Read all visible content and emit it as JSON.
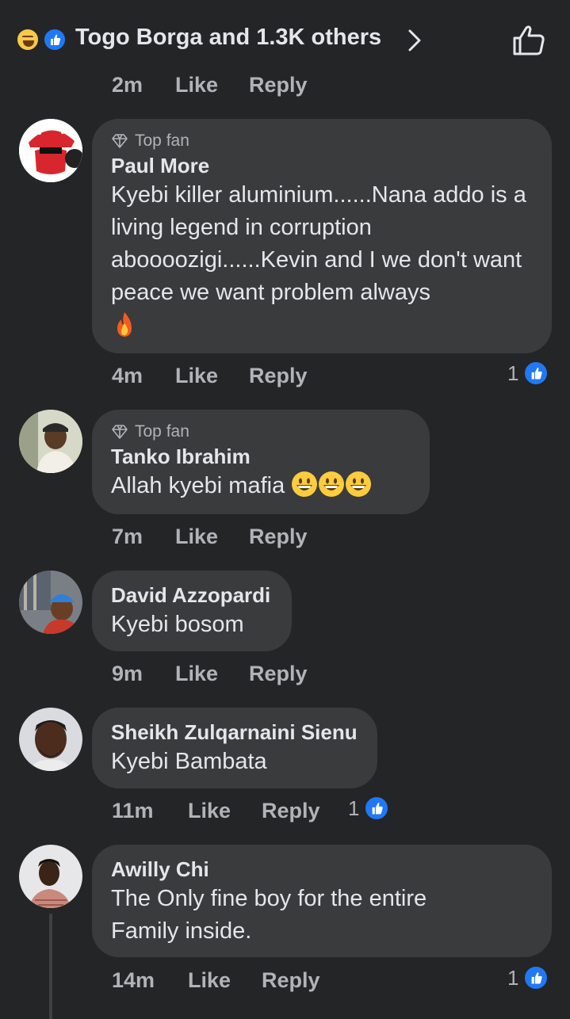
{
  "header": {
    "reactions_text": "Togo Borga and 1.3K others",
    "reaction_icons": [
      "haha-icon",
      "like-icon"
    ]
  },
  "top_meta": {
    "time": "2m",
    "like": "Like",
    "reply": "Reply"
  },
  "comments": [
    {
      "badge": "Top fan",
      "name": "Paul More",
      "text": "Kyebi killer aluminium......Nana addo is a living legend in corruption aboooozigi......Kevin and I we don't want peace we want problem always",
      "emoji": "fire-emoji",
      "time": "4m",
      "like": "Like",
      "reply": "Reply",
      "reaction_count": "1"
    },
    {
      "badge": "Top fan",
      "name": "Tanko Ibrahim",
      "text": "Allah kyebi mafia",
      "emoji": "grinning-face-emoji x3",
      "time": "7m",
      "like": "Like",
      "reply": "Reply"
    },
    {
      "name": "David Azzopardi",
      "text": "Kyebi bosom",
      "time": "9m",
      "like": "Like",
      "reply": "Reply"
    },
    {
      "name": "Sheikh Zulqarnaini Sienu",
      "text": "Kyebi Bambata",
      "time": "11m",
      "like": "Like",
      "reply": "Reply",
      "reaction_count": "1"
    },
    {
      "name": "Awilly Chi",
      "text": "The Only fine boy for the entire Family inside.",
      "time": "14m",
      "like": "Like",
      "reply": "Reply",
      "reaction_count": "1"
    }
  ],
  "colors": {
    "background": "#242526",
    "bubble": "#3a3b3c",
    "like_blue": "#2078f4",
    "muted": "#b0b3b8"
  }
}
